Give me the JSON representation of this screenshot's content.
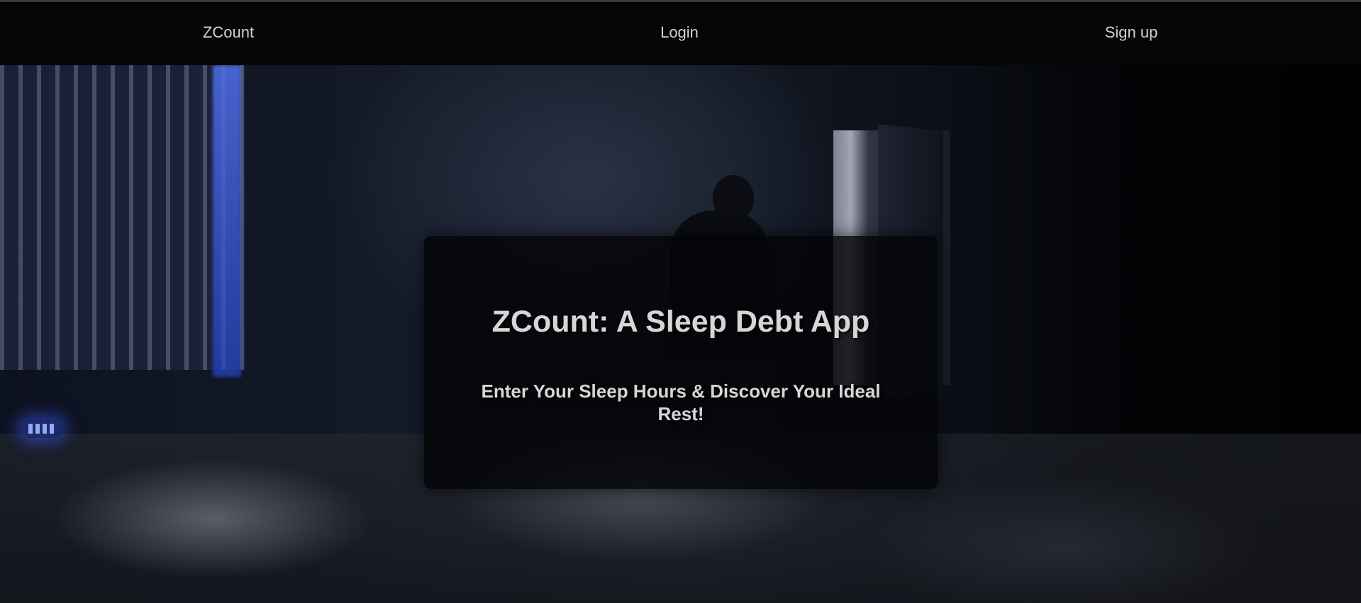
{
  "navbar": {
    "brand": "ZCount",
    "login": "Login",
    "signup": "Sign up"
  },
  "hero": {
    "title": "ZCount: A Sleep Debt App",
    "subtitle": "Enter Your Sleep Hours & Discover Your Ideal Rest!"
  },
  "colors": {
    "navbar_background": "#050505",
    "nav_text": "#d2d2d2",
    "card_background": "#040406",
    "card_text": "#d6d6d6"
  }
}
